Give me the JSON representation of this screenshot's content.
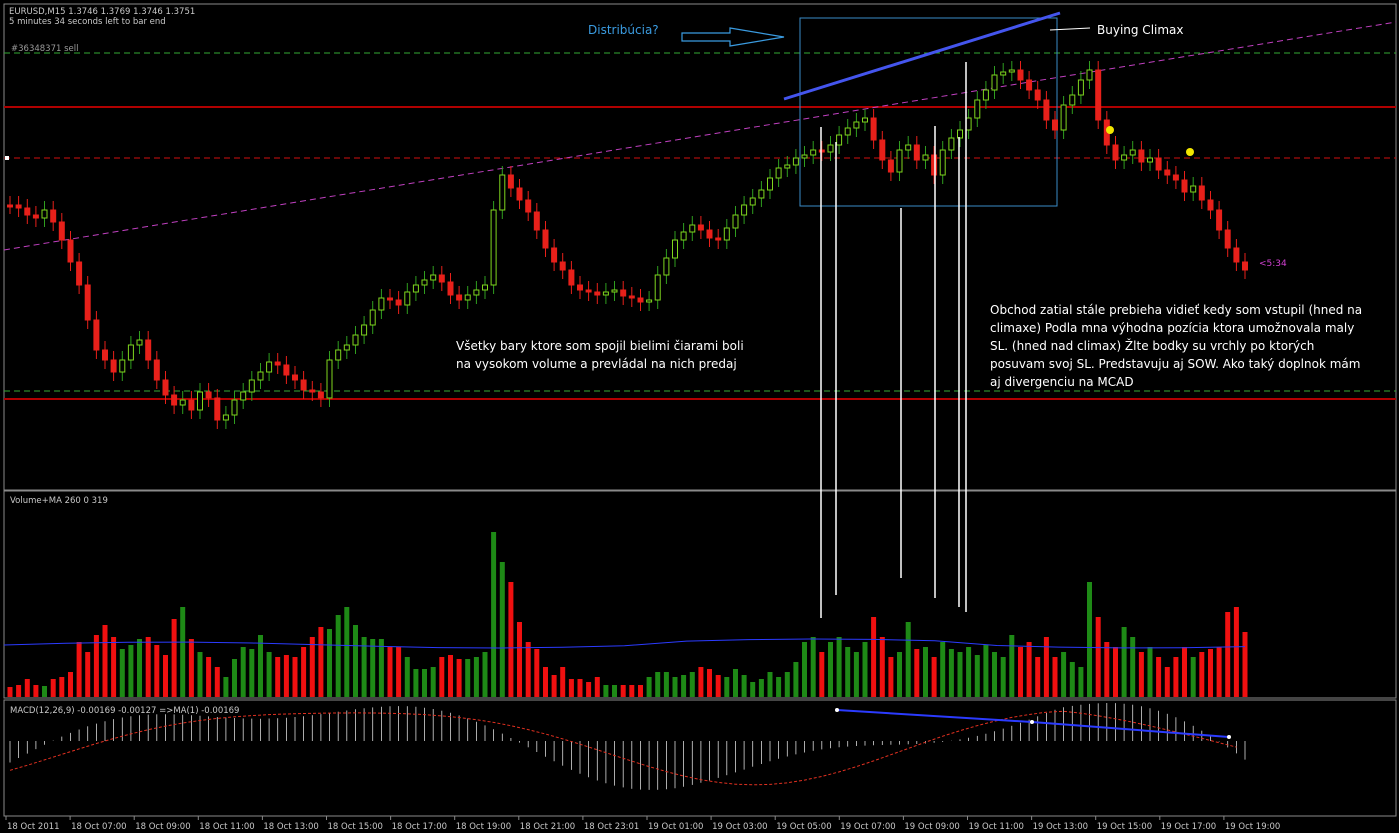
{
  "header": {
    "symbol_line": "EURUSD,M15  1.3746 1.3769 1.3746 1.3751",
    "timer": "5 minutes 34 seconds left to bar end",
    "order_label": "#36348371 sell"
  },
  "price_label": "<5:34",
  "volume_label": "Volume+MA 260 0 319",
  "macd_label": "MACD(12,26,9) -0.00169 -0.00127  =>MA(1) -0.00169",
  "annotations": {
    "distribucia": "Distribúcia?",
    "buying_climax": "Buying Climax",
    "note_left_1": "Všetky bary ktore som spojil bielimi čiarami boli",
    "note_left_2": "na vysokom volume a prevládal na nich predaj",
    "note_right_1": "Obchod zatial stále prebieha vidieť kedy som vstupil (hned na",
    "note_right_2": "climaxe) Podla mna výhodna pozícia ktora umožnovala maly",
    "note_right_3": "SL. (hned nad climax) Žlte bodky su vrchly po ktorých",
    "note_right_4": "posuvam svoj SL. Predstavuju aj SOW. Ako taký doplnok mám",
    "note_right_5": "aj divergenciu na MCAD"
  },
  "colors": {
    "bull": "#2f9e1f",
    "bull_body": "#7fd61e",
    "bear": "#e8201a",
    "volume_green": "#1e8a16",
    "volume_red": "#f01010",
    "ma_blue": "#2b3bff",
    "macd_red": "#e03020",
    "level_red": "#b00000",
    "level_green": "#33aa33",
    "trend_magenta": "#c040c0",
    "box_blue": "#3a8cc8",
    "note_blue": "#3a9be0",
    "yellow": "#f2e600"
  },
  "chart_data": {
    "type": "candlestick",
    "x_ticks": [
      "18 Oct 2011",
      "18 Oct 07:00",
      "18 Oct 09:00",
      "18 Oct 11:00",
      "18 Oct 13:00",
      "18 Oct 15:00",
      "18 Oct 17:00",
      "18 Oct 19:00",
      "18 Oct 21:00",
      "18 Oct 23:01",
      "19 Oct 01:00",
      "19 Oct 03:00",
      "19 Oct 05:00",
      "19 Oct 07:00",
      "19 Oct 09:00",
      "19 Oct 11:00",
      "19 Oct 13:00",
      "19 Oct 15:00",
      "19 Oct 17:00",
      "19 Oct 19:00"
    ],
    "last_price": 1.3751,
    "volume_ma": 260,
    "volume_last": 319,
    "macd": {
      "fast": 12,
      "slow": 26,
      "signal": 9,
      "main": -0.00169,
      "signal_value": -0.00127
    }
  }
}
